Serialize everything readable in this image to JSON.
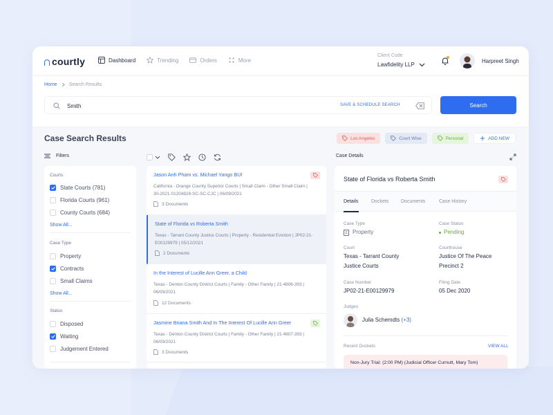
{
  "brand": {
    "name": "courtly",
    "accent": "#2f6df0"
  },
  "nav": [
    {
      "label": "Dashboard",
      "icon": "layout-icon",
      "active": true
    },
    {
      "label": "Trending",
      "icon": "star-icon",
      "active": false
    },
    {
      "label": "Orders",
      "icon": "card-icon",
      "active": false
    },
    {
      "label": "More",
      "icon": "grid-icon",
      "active": false
    }
  ],
  "client": {
    "label": "Client Code",
    "value": "Lawfidelity LLP"
  },
  "user": {
    "name": "Harpreet Singh"
  },
  "breadcrumb": {
    "home": "Home",
    "current": "Search Results"
  },
  "search": {
    "value": "Smith",
    "save_label": "SAVE & SCHEDULE SEARCH",
    "button": "Search"
  },
  "results": {
    "title": "Case Search Results"
  },
  "chips": [
    {
      "label": "Los Angeles",
      "tone": "red"
    },
    {
      "label": "Court Wise",
      "tone": "blue"
    },
    {
      "label": "Personal",
      "tone": "green"
    },
    {
      "label": "ADD NEW",
      "tone": "add"
    }
  ],
  "filters": {
    "label": "Filters",
    "show_all": "Show All...",
    "groups": [
      {
        "title": "Courts",
        "options": [
          {
            "label": "State Courts (781)",
            "checked": true
          },
          {
            "label": "Florida Courts (961)",
            "checked": false
          },
          {
            "label": "County Courts (684)",
            "checked": false
          }
        ]
      },
      {
        "title": "Case Type",
        "options": [
          {
            "label": "Property",
            "checked": false
          },
          {
            "label": "Contracts",
            "checked": true
          },
          {
            "label": "Small Claims",
            "checked": false
          }
        ]
      },
      {
        "title": "Status",
        "options": [
          {
            "label": "Disposed",
            "checked": false
          },
          {
            "label": "Waiting",
            "checked": true
          },
          {
            "label": "Judgement Entered",
            "checked": false
          }
        ]
      }
    ]
  },
  "cases": [
    {
      "title": "Jason Anh Pham vs. Michael Yango BUI",
      "meta1": "California - Orange County Superior Courts | Small Claim - Other Small Claim |",
      "meta2": "30-2021-01204828-SC-SC-CJC | 06/09/2021",
      "docs": "3 Documents",
      "tag": "red"
    },
    {
      "title": "State of Florida vs Roberta Smith",
      "meta1": "Texas - Tarrant County Justice Courts | Property - Residential Eviction | JP02-21-",
      "meta2": "E00129979 | 05/12/2021",
      "docs": "2 Documents",
      "tag": ""
    },
    {
      "title": "In the Interest of Lucille Ann Greer, a Child",
      "meta1": "Texas - Denton County District Courts | Family - Other Family | 21-4806-393 |",
      "meta2": "06/09/2021",
      "docs": "12 Documents",
      "tag": ""
    },
    {
      "title": "Jasmine Briana Smith And In The Interest Of Lucille Ann Greer",
      "meta1": "Texas - Denton County District Courts | Family - Other Family | 21-4807-393 |",
      "meta2": "06/09/2021",
      "docs": "3 Documents",
      "tag": "green"
    }
  ],
  "details": {
    "label": "Case Details",
    "title": "State of Florida vs Roberta Smith",
    "tabs": [
      "Details",
      "Dockets",
      "Documents",
      "Case History"
    ],
    "case_type_label": "Case Type",
    "case_type": "Property",
    "case_status_label": "Case Status",
    "case_status": "Pending",
    "court_label": "Court",
    "court_line1": "Texas - Tarrant County",
    "court_line2": "Justice Courts",
    "courthouse_label": "Courthouse",
    "courthouse_line1": "Justice Of The Peace",
    "courthouse_line2": "Precinct 2",
    "case_number_label": "Case Number",
    "case_number": "JP02-21-E00129979",
    "filing_date_label": "Filing Date",
    "filing_date": "05 Dec 2020",
    "judges_label": "Judges",
    "judge": "Julia Schemdts",
    "judge_more": "(+3)",
    "recent_label": "Recent Dockets",
    "view_all": "VIEW ALL",
    "docket": "Non-Jury Trial: (2:00 PM) (Judicial Officer Curnutt, Mary Tom)"
  }
}
